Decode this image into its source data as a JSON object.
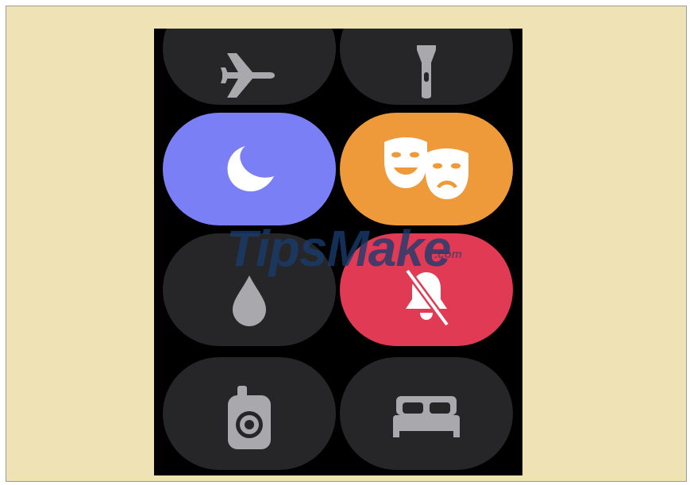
{
  "watermark": {
    "brand": "TipsMake",
    "suffix": ".com"
  },
  "colors": {
    "page_background": "#efe3b5",
    "screen_background": "#000000",
    "tile_off": "#262628",
    "icon_off": "#a9a9ad",
    "theater_mode_on": "#ef9a3a",
    "do_not_disturb_on": "#7b7ff6",
    "silent_mode_on": "#e03a55",
    "icon_on": "#ffffff"
  },
  "control_center": {
    "tiles": [
      {
        "name": "airplane-mode",
        "icon": "airplane-icon",
        "active": false
      },
      {
        "name": "flashlight",
        "icon": "flashlight-icon",
        "active": false
      },
      {
        "name": "do-not-disturb",
        "icon": "moon-icon",
        "active": true
      },
      {
        "name": "theater-mode",
        "icon": "theater-masks-icon",
        "active": true
      },
      {
        "name": "water-lock",
        "icon": "water-drop-icon",
        "active": false
      },
      {
        "name": "silent-mode",
        "icon": "bell-slash-icon",
        "active": true
      },
      {
        "name": "walkie-talkie",
        "icon": "walkie-talkie-icon",
        "active": false
      },
      {
        "name": "sleep-mode",
        "icon": "bed-icon",
        "active": false
      }
    ]
  }
}
